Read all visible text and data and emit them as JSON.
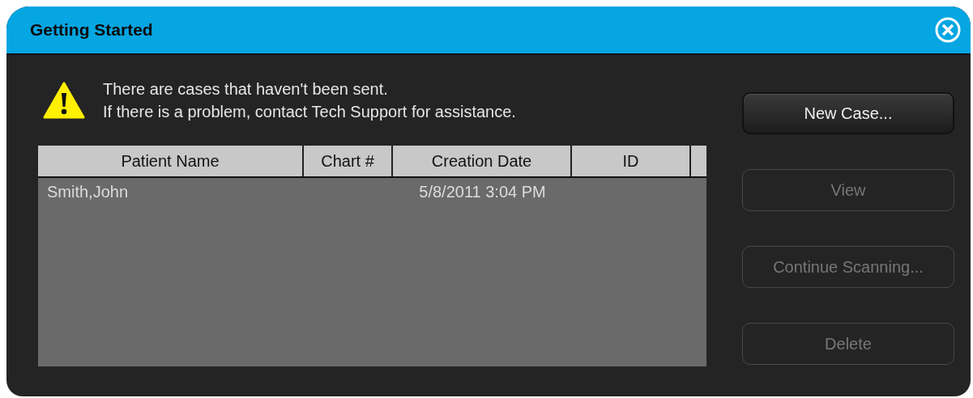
{
  "window": {
    "title": "Getting Started"
  },
  "message": [
    "There are cases that haven't been sent.",
    "If there is a problem, contact Tech Support for assistance."
  ],
  "table": {
    "columns": [
      "Patient Name",
      "Chart #",
      "Creation Date",
      "ID"
    ],
    "rows": [
      {
        "cells": [
          "Smith,John",
          null,
          "5/8/2011 3:04 PM",
          null
        ]
      }
    ]
  },
  "buttons": [
    {
      "label": "New Case...",
      "disabled": false
    },
    {
      "label": "View",
      "disabled": true
    },
    {
      "label": "Continue Scanning...",
      "disabled": true
    },
    {
      "label": "Delete",
      "disabled": true
    }
  ]
}
